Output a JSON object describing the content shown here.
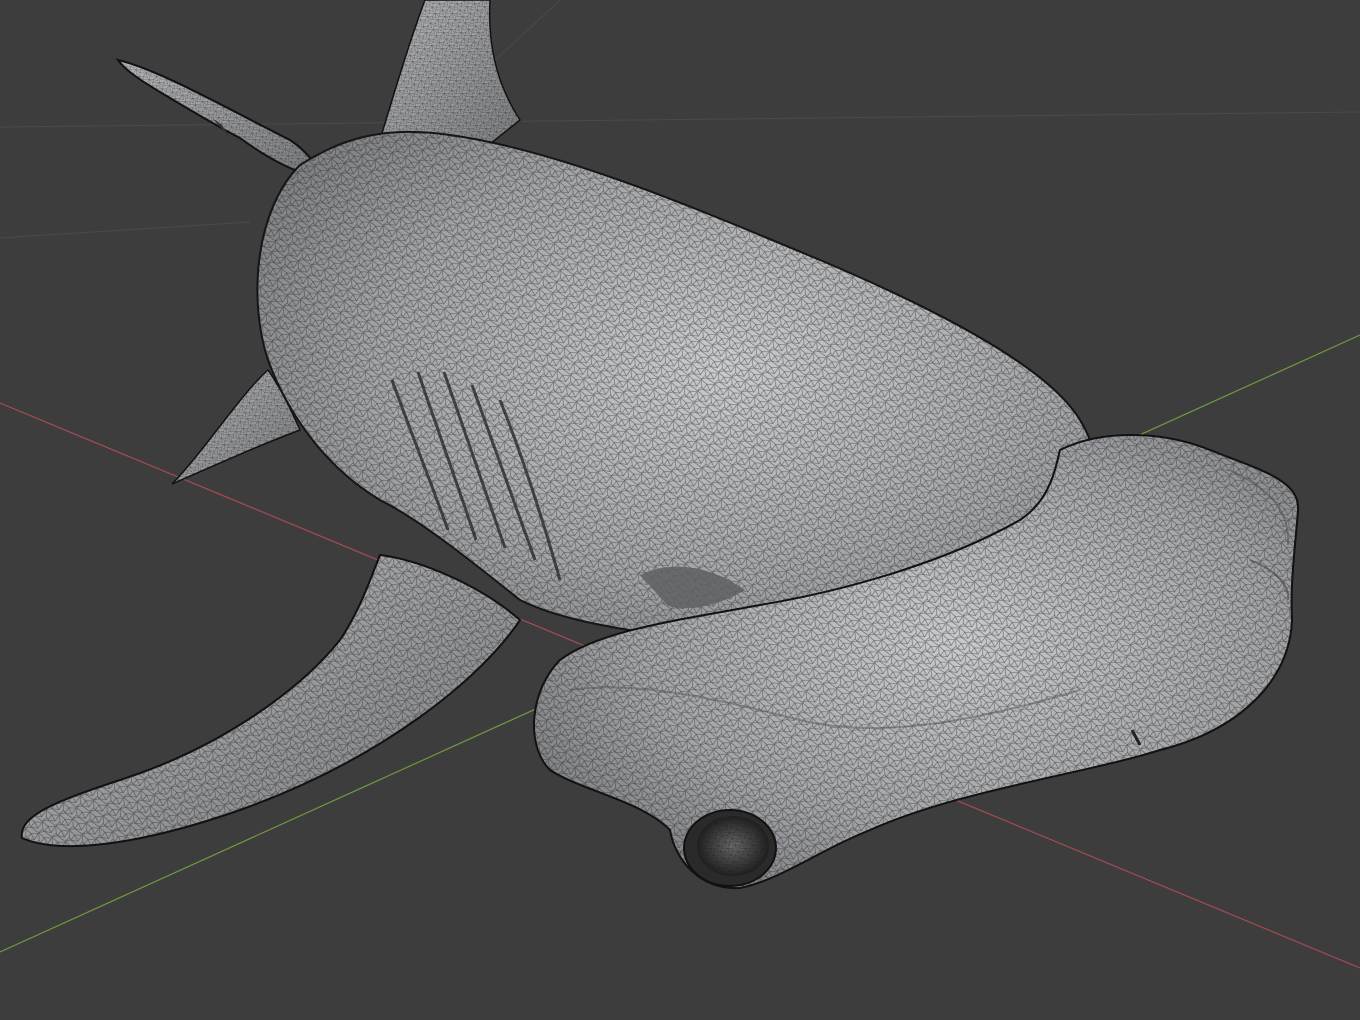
{
  "viewport": {
    "background_color": "#3d3d3d",
    "grid_line_color": "#4a4a4a",
    "x_axis_color": "#a84a55",
    "y_axis_color": "#6f9a3d",
    "mesh_fill_color": "#9a9c9f",
    "mesh_highlight_color": "#c6c8ca",
    "mesh_shadow_color": "#5e6063",
    "wire_color": "#1c1c1c",
    "show_wireframe": true,
    "model": "hammerhead-shark-icon"
  }
}
